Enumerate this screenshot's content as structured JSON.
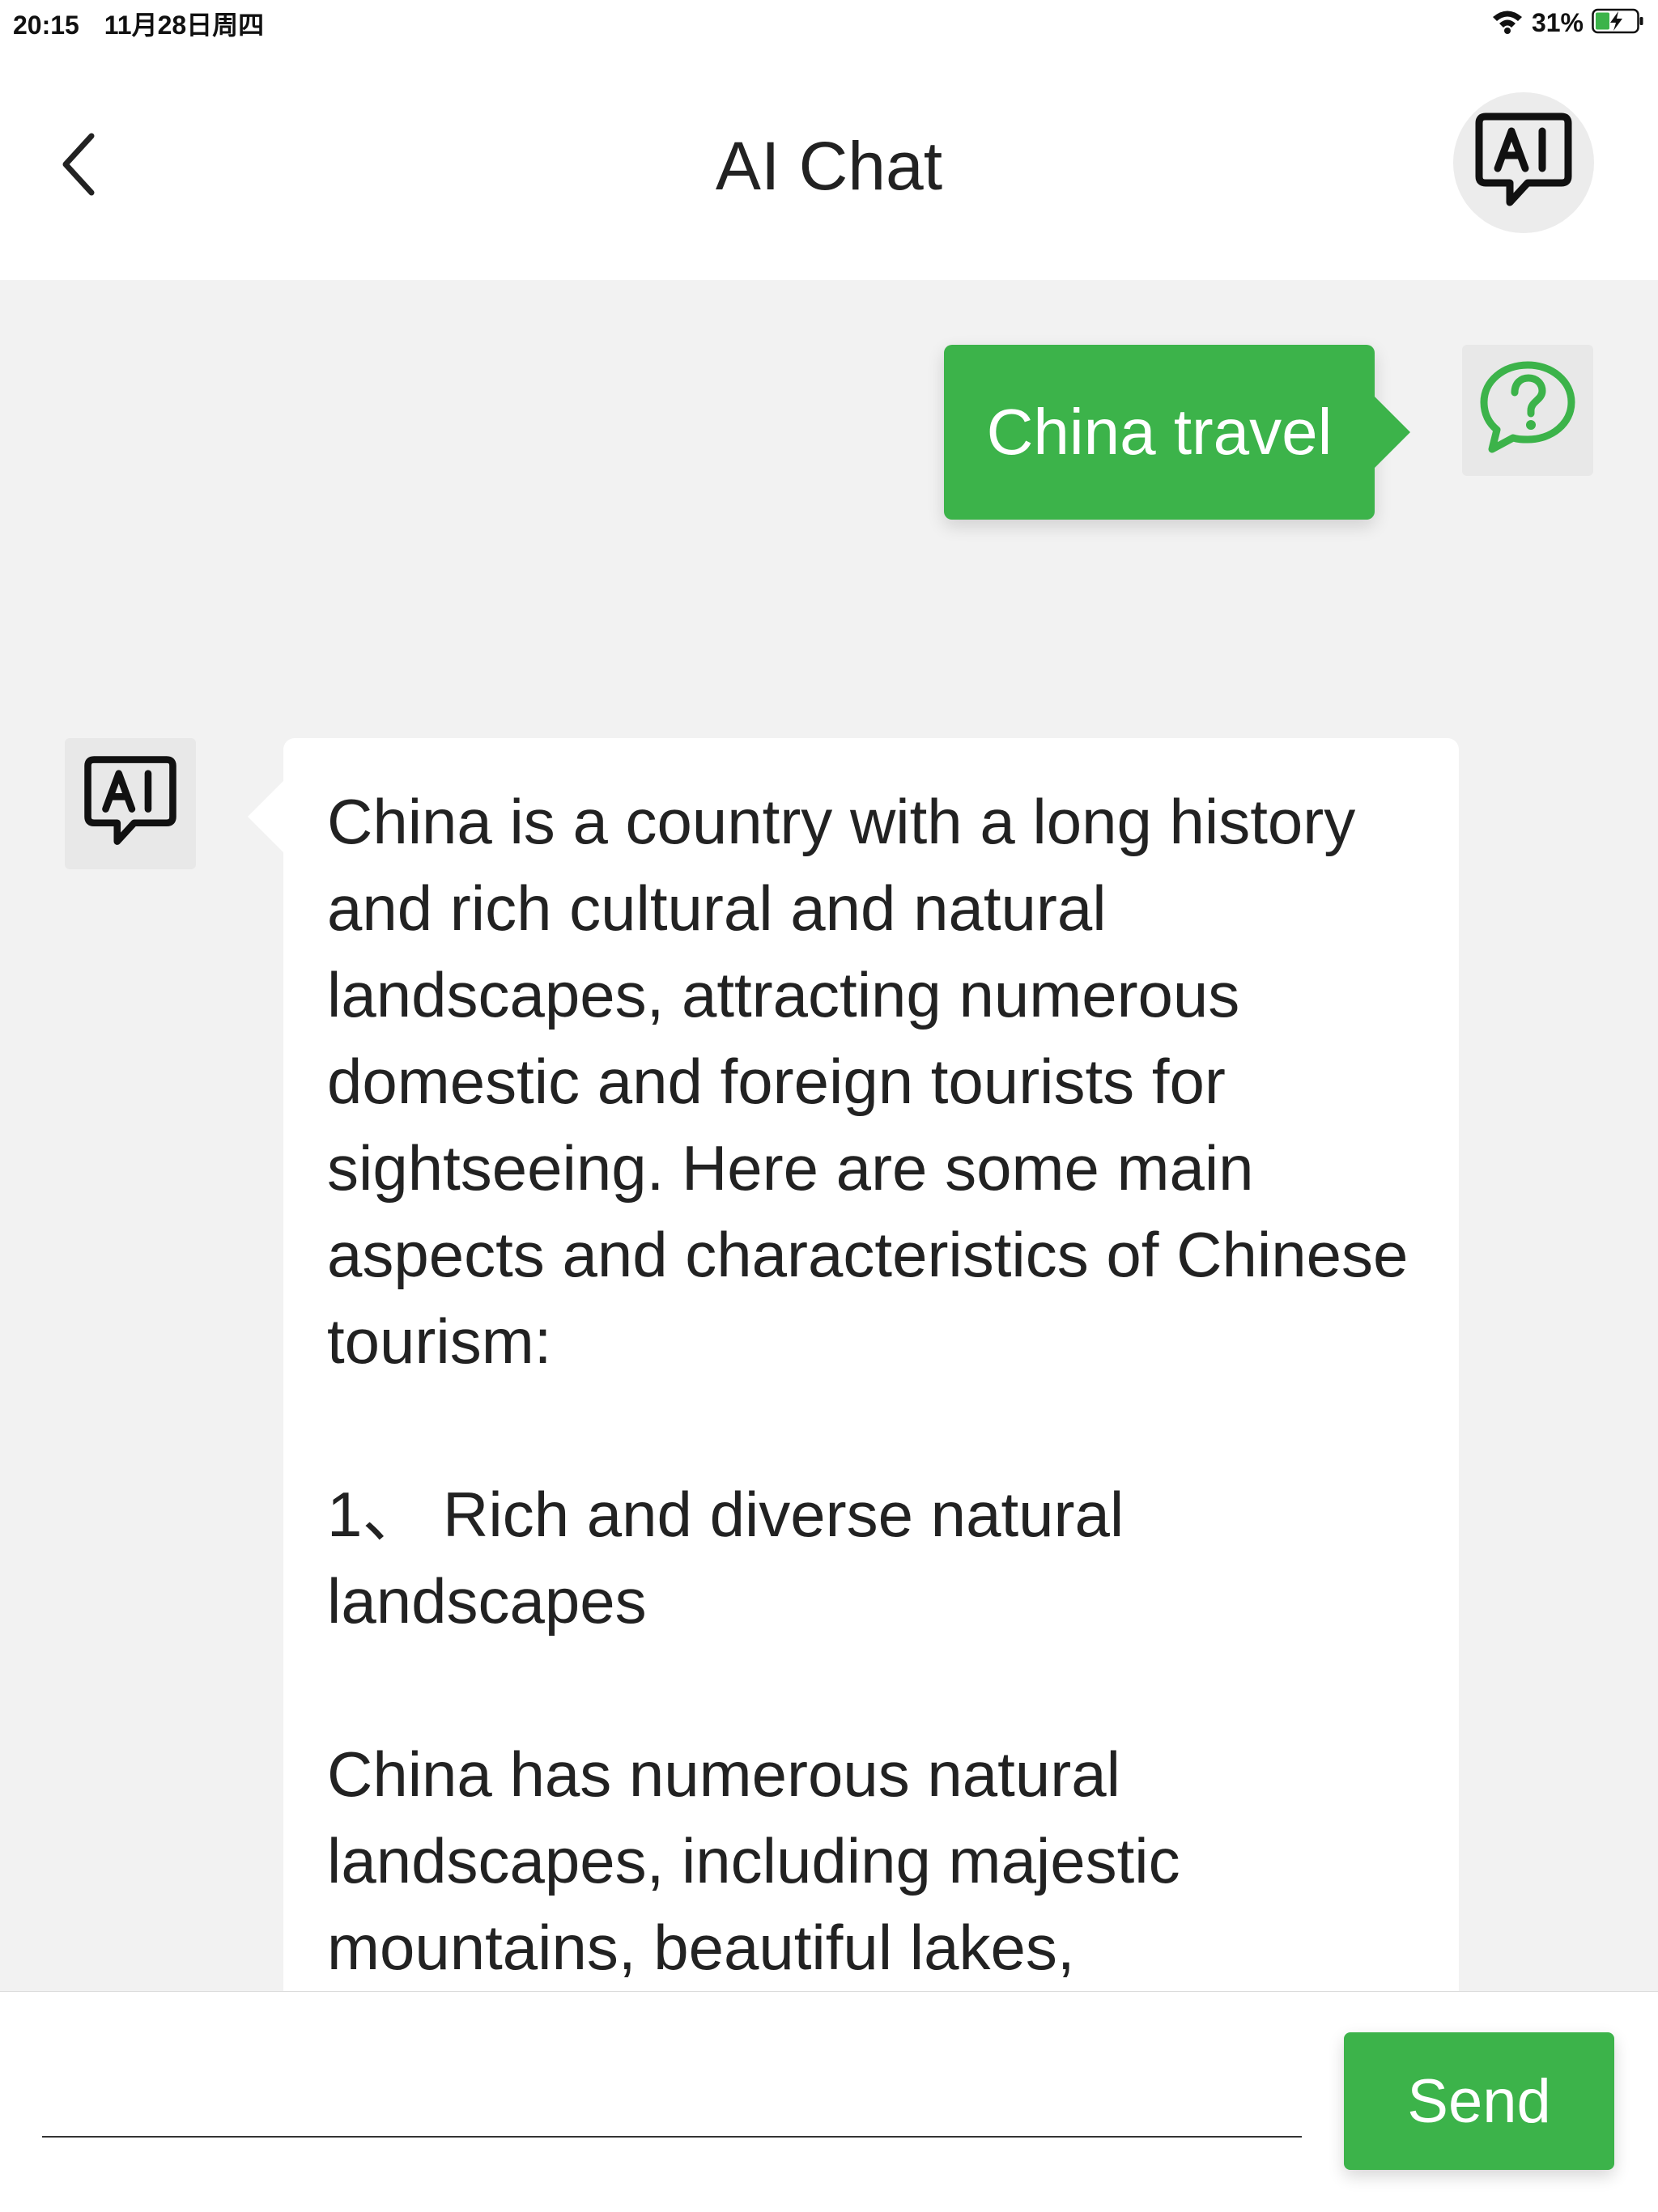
{
  "status_bar": {
    "time": "20:15",
    "date": "11月28日周四",
    "battery_percent": "31%",
    "icons": [
      "wifi-icon",
      "battery-charging-icon"
    ]
  },
  "header": {
    "title": "AI Chat",
    "icons": [
      "back-chevron-icon",
      "ai-chat-icon"
    ]
  },
  "chat": {
    "messages": [
      {
        "role": "user",
        "text": "China travel",
        "avatar_icon": "question-chat-icon"
      },
      {
        "role": "assistant",
        "avatar_icon": "ai-chat-icon",
        "paragraphs": [
          "China is a country with a long history and rich cultural and natural landscapes, attracting numerous domestic and foreign tourists for sightseeing. Here are some main aspects and characteristics of Chinese tourism:",
          "1、 Rich and diverse natural landscapes",
          "China has numerous natural landscapes, including majestic mountains, beautiful lakes,"
        ]
      }
    ]
  },
  "input_bar": {
    "input_value": "",
    "input_placeholder": "",
    "send_label": "Send"
  },
  "colors": {
    "accent_green": "#3cb34a",
    "chat_background": "#f2f2f2",
    "bubble_white": "#ffffff"
  }
}
